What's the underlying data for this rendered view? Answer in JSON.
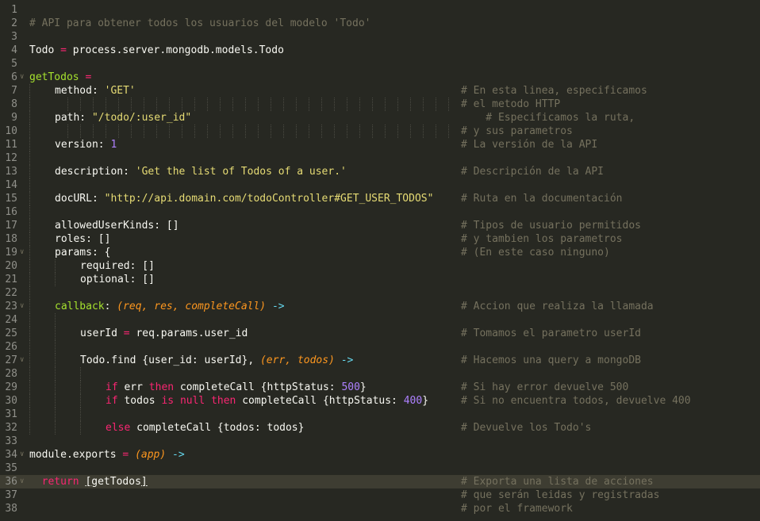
{
  "editor": {
    "theme_colors": {
      "background": "#272822",
      "current_line": "#3e3d32",
      "comment": "#75715e",
      "string": "#e6db74",
      "number": "#ae81ff",
      "keyword": "#f92672",
      "function": "#a6e22e",
      "parameter": "#fd971f",
      "arrow": "#66d9ef",
      "text": "#f8f8f2",
      "gutter_text": "#90908a"
    },
    "current_line": 36,
    "fold_markers": [
      6,
      19,
      23,
      27,
      34,
      36
    ],
    "lines": [
      {
        "n": "1",
        "indent": 0,
        "tokens": []
      },
      {
        "n": "2",
        "indent": 0,
        "tokens": [
          {
            "t": "# API para obtener todos los usuarios del modelo 'Todo'",
            "c": "c-com"
          }
        ]
      },
      {
        "n": "3",
        "indent": 0,
        "tokens": []
      },
      {
        "n": "4",
        "indent": 0,
        "tokens": [
          {
            "t": "Todo "
          },
          {
            "t": "=",
            "c": "c-kw"
          },
          {
            "t": " process.server.mongodb.models.Todo"
          }
        ]
      },
      {
        "n": "5",
        "indent": 0,
        "tokens": []
      },
      {
        "n": "6",
        "indent": 0,
        "tokens": [
          {
            "t": "getTodos",
            "c": "c-fn"
          },
          {
            "t": " "
          },
          {
            "t": "=",
            "c": "c-kw"
          }
        ]
      },
      {
        "n": "7",
        "indent": 1,
        "tokens": [
          {
            "t": "method: "
          },
          {
            "t": "'GET'",
            "c": "c-str"
          }
        ],
        "comment": "# En esta linea, especificamos"
      },
      {
        "n": "8",
        "indent": 1,
        "tokens": [],
        "comment": "# el metodo HTTP"
      },
      {
        "n": "9",
        "indent": 1,
        "tokens": [
          {
            "t": "path: "
          },
          {
            "t": "\"/todo/:user_id\"",
            "c": "c-str"
          }
        ],
        "comment": "    # Especificamos la ruta,"
      },
      {
        "n": "10",
        "indent": 1,
        "tokens": [],
        "comment": "# y sus parametros"
      },
      {
        "n": "11",
        "indent": 1,
        "tokens": [
          {
            "t": "version: "
          },
          {
            "t": "1",
            "c": "c-num"
          }
        ],
        "comment": "# La versión de la API"
      },
      {
        "n": "12",
        "indent": 1,
        "tokens": []
      },
      {
        "n": "13",
        "indent": 1,
        "tokens": [
          {
            "t": "description: "
          },
          {
            "t": "'Get the list of Todos of a user.'",
            "c": "c-str"
          }
        ],
        "comment": "# Descripción de la API"
      },
      {
        "n": "14",
        "indent": 1,
        "tokens": []
      },
      {
        "n": "15",
        "indent": 1,
        "tokens": [
          {
            "t": "docURL: "
          },
          {
            "t": "\"http://api.domain.com/todoController#GET_USER_TODOS\"",
            "c": "c-str"
          }
        ],
        "comment": "# Ruta en la documentación"
      },
      {
        "n": "16",
        "indent": 1,
        "tokens": []
      },
      {
        "n": "17",
        "indent": 1,
        "tokens": [
          {
            "t": "allowedUserKinds: []"
          }
        ],
        "comment": "# Tipos de usuario permitidos"
      },
      {
        "n": "18",
        "indent": 1,
        "tokens": [
          {
            "t": "roles: []"
          }
        ],
        "comment": "# y tambien los parametros"
      },
      {
        "n": "19",
        "indent": 1,
        "tokens": [
          {
            "t": "params: {"
          }
        ],
        "comment": "# (En este caso ninguno)"
      },
      {
        "n": "20",
        "indent": 2,
        "tokens": [
          {
            "t": "required: []"
          }
        ]
      },
      {
        "n": "21",
        "indent": 2,
        "tokens": [
          {
            "t": "optional: []"
          }
        ]
      },
      {
        "n": "22",
        "indent": 1,
        "tokens": []
      },
      {
        "n": "23",
        "indent": 1,
        "tokens": [
          {
            "t": "callback",
            "c": "c-fn"
          },
          {
            "t": ": "
          },
          {
            "t": "(req, res, completeCall)",
            "c": "c-prm"
          },
          {
            "t": " "
          },
          {
            "t": "->",
            "c": "c-arr"
          }
        ],
        "comment": "# Accion que realiza la llamada"
      },
      {
        "n": "24",
        "indent": 2,
        "tokens": []
      },
      {
        "n": "25",
        "indent": 2,
        "tokens": [
          {
            "t": "userId "
          },
          {
            "t": "=",
            "c": "c-kw"
          },
          {
            "t": " req.params.user_id"
          }
        ],
        "comment": "# Tomamos el parametro userId"
      },
      {
        "n": "26",
        "indent": 2,
        "tokens": []
      },
      {
        "n": "27",
        "indent": 2,
        "tokens": [
          {
            "t": "Todo.find {user_id: userId}, "
          },
          {
            "t": "(err, todos)",
            "c": "c-prm"
          },
          {
            "t": " "
          },
          {
            "t": "->",
            "c": "c-arr"
          }
        ],
        "comment": "# Hacemos una query a mongoDB"
      },
      {
        "n": "28",
        "indent": 3,
        "tokens": []
      },
      {
        "n": "29",
        "indent": 3,
        "tokens": [
          {
            "t": "if",
            "c": "c-kw"
          },
          {
            "t": " err "
          },
          {
            "t": "then",
            "c": "c-kw"
          },
          {
            "t": " completeCall {httpStatus: "
          },
          {
            "t": "500",
            "c": "c-num"
          },
          {
            "t": "}"
          }
        ],
        "comment": "# Si hay error devuelve 500"
      },
      {
        "n": "30",
        "indent": 3,
        "tokens": [
          {
            "t": "if",
            "c": "c-kw"
          },
          {
            "t": " todos "
          },
          {
            "t": "is",
            "c": "c-kw"
          },
          {
            "t": " "
          },
          {
            "t": "null",
            "c": "c-kw"
          },
          {
            "t": " "
          },
          {
            "t": "then",
            "c": "c-kw"
          },
          {
            "t": " completeCall {httpStatus: "
          },
          {
            "t": "400",
            "c": "c-num"
          },
          {
            "t": "}"
          }
        ],
        "comment": "# Si no encuentra todos, devuelve 400"
      },
      {
        "n": "31",
        "indent": 3,
        "tokens": []
      },
      {
        "n": "32",
        "indent": 3,
        "tokens": [
          {
            "t": "else",
            "c": "c-kw"
          },
          {
            "t": " completeCall {todos: todos}"
          }
        ],
        "comment": "# Devuelve los Todo's"
      },
      {
        "n": "33",
        "indent": 0,
        "tokens": []
      },
      {
        "n": "34",
        "indent": 0,
        "tokens": [
          {
            "t": "module.exports "
          },
          {
            "t": "=",
            "c": "c-kw"
          },
          {
            "t": " "
          },
          {
            "t": "(app)",
            "c": "c-prm"
          },
          {
            "t": " "
          },
          {
            "t": "->",
            "c": "c-arr"
          }
        ]
      },
      {
        "n": "35",
        "indent": 0,
        "tokens": []
      },
      {
        "n": "36",
        "indent": 0,
        "tokens": [
          {
            "t": "  "
          },
          {
            "t": "return",
            "c": "c-kw"
          },
          {
            "t": " "
          },
          {
            "t": "[",
            "c": "c-br"
          },
          {
            "t": "getTodos"
          },
          {
            "t": "]",
            "c": "c-br"
          }
        ],
        "comment": "# Exporta una lista de acciones"
      },
      {
        "n": "37",
        "indent": 0,
        "tokens": [],
        "comment": "# que serán leidas y registradas"
      },
      {
        "n": "38",
        "indent": 0,
        "tokens": [],
        "comment": "# por el framework"
      }
    ]
  }
}
